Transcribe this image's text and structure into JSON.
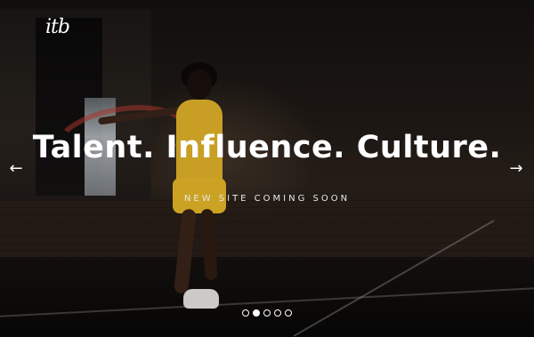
{
  "brand": {
    "logo_text": "itb"
  },
  "hero": {
    "headline": "Talent. Influence. Culture.",
    "subheadline": "NEW SITE COMING SOON"
  },
  "navigation": {
    "prev_icon": "arrow-left-icon",
    "next_icon": "arrow-right-icon",
    "prev_glyph": "←",
    "next_glyph": "→"
  },
  "carousel": {
    "slide_count": 5,
    "active_index": 1,
    "dot_color": "#ffffff"
  },
  "colors": {
    "text": "#ffffff",
    "accent_outfit": "#e4b62a"
  }
}
